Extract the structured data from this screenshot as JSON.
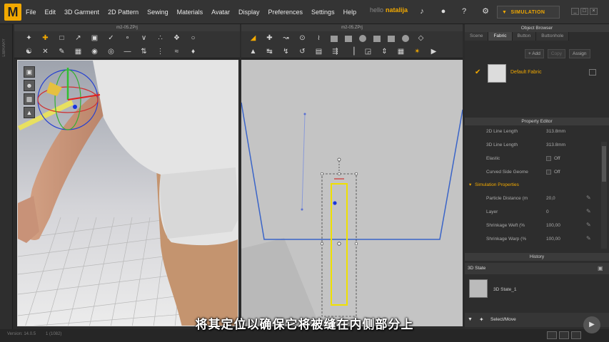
{
  "menubar": {
    "logo": "M",
    "items": [
      "File",
      "Edit",
      "3D Garment",
      "2D Pattern",
      "Sewing",
      "Materials",
      "Avatar",
      "Display",
      "Preferences",
      "Settings",
      "Help"
    ],
    "user_greeting": "hello",
    "user_name": "natalija",
    "simulation_label": "SIMULATION"
  },
  "left_strip": {
    "label": "LIBRARY"
  },
  "view3d": {
    "tab_title": "m2-05.ZPrj"
  },
  "view2d": {
    "tab_title": "m2-05.ZPrj"
  },
  "object_browser": {
    "title": "Object Browser",
    "tabs": [
      "Scene",
      "Fabric",
      "Button",
      "Buttonhole"
    ],
    "active_tab": "Fabric",
    "buttons": [
      "+ Add",
      "Copy",
      "Assign"
    ],
    "fabric_name": "Default Fabric"
  },
  "property_editor": {
    "title": "Property Editor",
    "rows": [
      {
        "label": "2D Line Length",
        "value": "313.8mm"
      },
      {
        "label": "3D Line Length",
        "value": "313.8mm"
      }
    ],
    "elastic": {
      "label": "Elastic",
      "value": "Off"
    },
    "curved": {
      "label": "Curved Side Geome",
      "value": "Off"
    },
    "section_title": "Simulation Properties",
    "sim_rows": [
      {
        "label": "Particle Distance (m",
        "value": "20,0"
      },
      {
        "label": "Layer",
        "value": "0"
      },
      {
        "label": "Shrinkage Weft (%",
        "value": "100,00"
      },
      {
        "label": "Shrinkage Warp (%",
        "value": "100,00"
      }
    ]
  },
  "history": {
    "title": "History",
    "state_header": "3D State",
    "state_item": "3D State_1",
    "select_move": "Select/Move"
  },
  "status": {
    "version": "Version: 14.0.5",
    "ids": "1 (1082)"
  },
  "subtitle": "将其定位以确保它将被缝在内侧部分上",
  "colors": {
    "accent": "#f2a900",
    "pattern_line": "#3a64c8",
    "selection": "#f0e000"
  }
}
